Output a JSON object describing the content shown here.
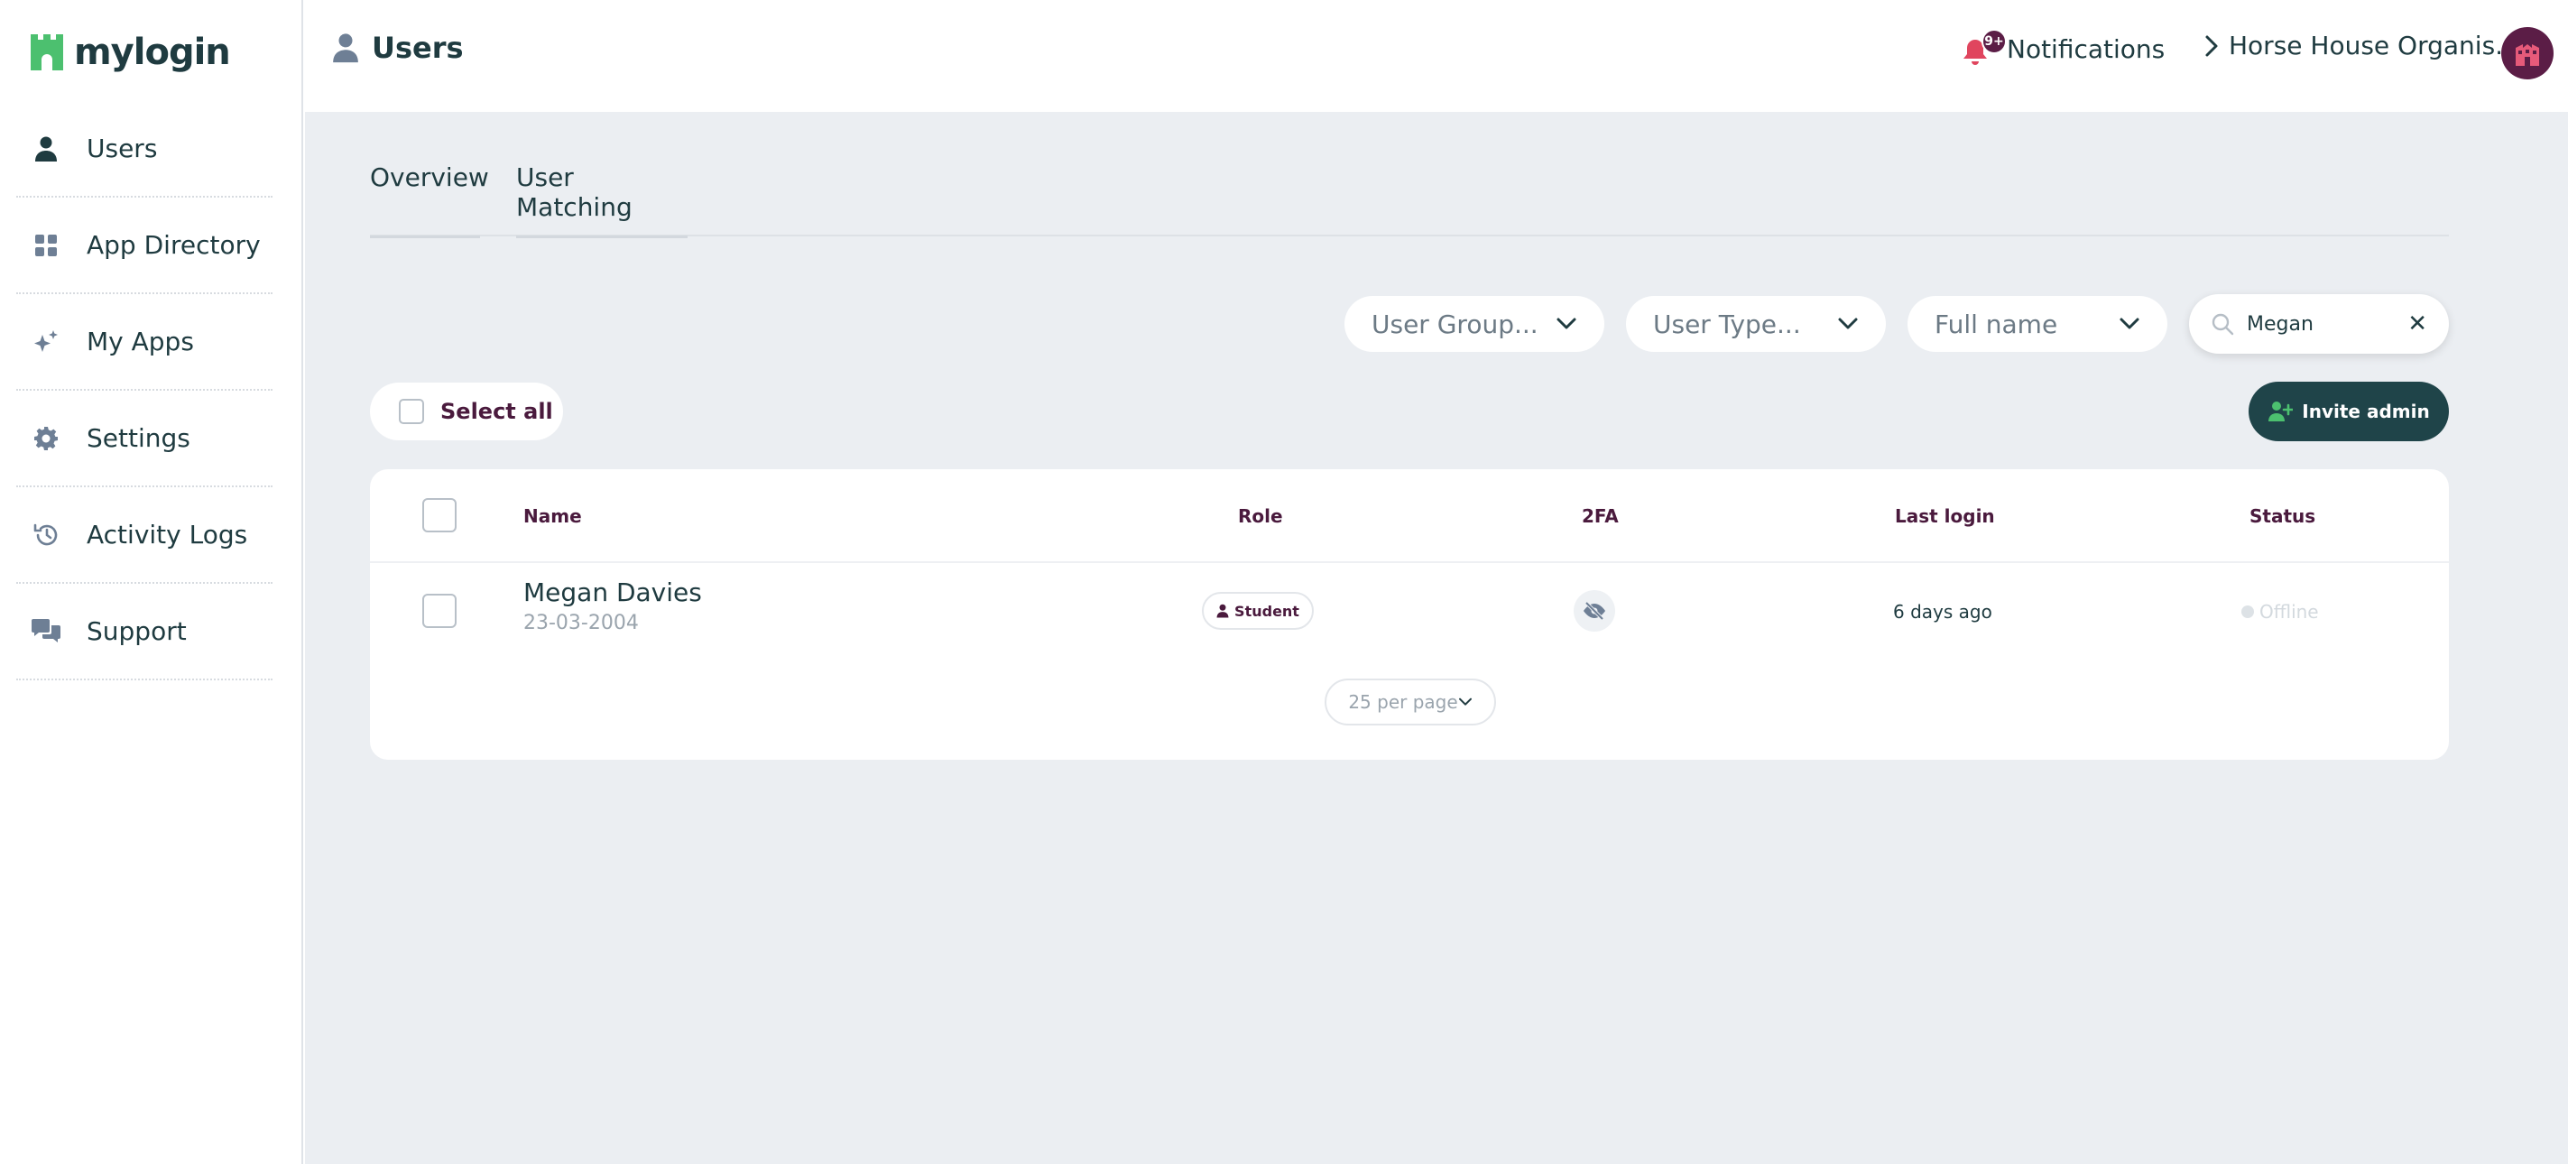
{
  "app": {
    "brand": "mylogin",
    "brand_color": "#4cc06f",
    "accent": "#5b1d46"
  },
  "sidebar": {
    "items": [
      {
        "label": "Users",
        "icon": "user-icon"
      },
      {
        "label": "App Directory",
        "icon": "grid-icon"
      },
      {
        "label": "My Apps",
        "icon": "sparkle-icon"
      },
      {
        "label": "Settings",
        "icon": "gear-icon"
      },
      {
        "label": "Activity Logs",
        "icon": "history-icon"
      },
      {
        "label": "Support",
        "icon": "chat-icon"
      }
    ]
  },
  "header": {
    "title": "Users",
    "notifications_label": "Notifications",
    "notifications_badge": "9+",
    "organisation": "Horse House Organis..."
  },
  "tabs": [
    {
      "label": "Overview"
    },
    {
      "label": "User Matching"
    }
  ],
  "filters": {
    "user_group": "User Group...",
    "user_type": "User Type...",
    "sort": "Full name",
    "search_value": "Megan"
  },
  "actions": {
    "select_all": "Select all",
    "invite_admin": "Invite admin"
  },
  "table": {
    "columns": {
      "name": "Name",
      "role": "Role",
      "twofa": "2FA",
      "last_login": "Last login",
      "status": "Status"
    },
    "rows": [
      {
        "name": "Megan Davies",
        "dob": "23-03-2004",
        "role": "Student",
        "twofa_icon": "eye-off-icon",
        "last_login": "6 days ago",
        "status": "Offline"
      }
    ],
    "per_page": "25 per page"
  }
}
